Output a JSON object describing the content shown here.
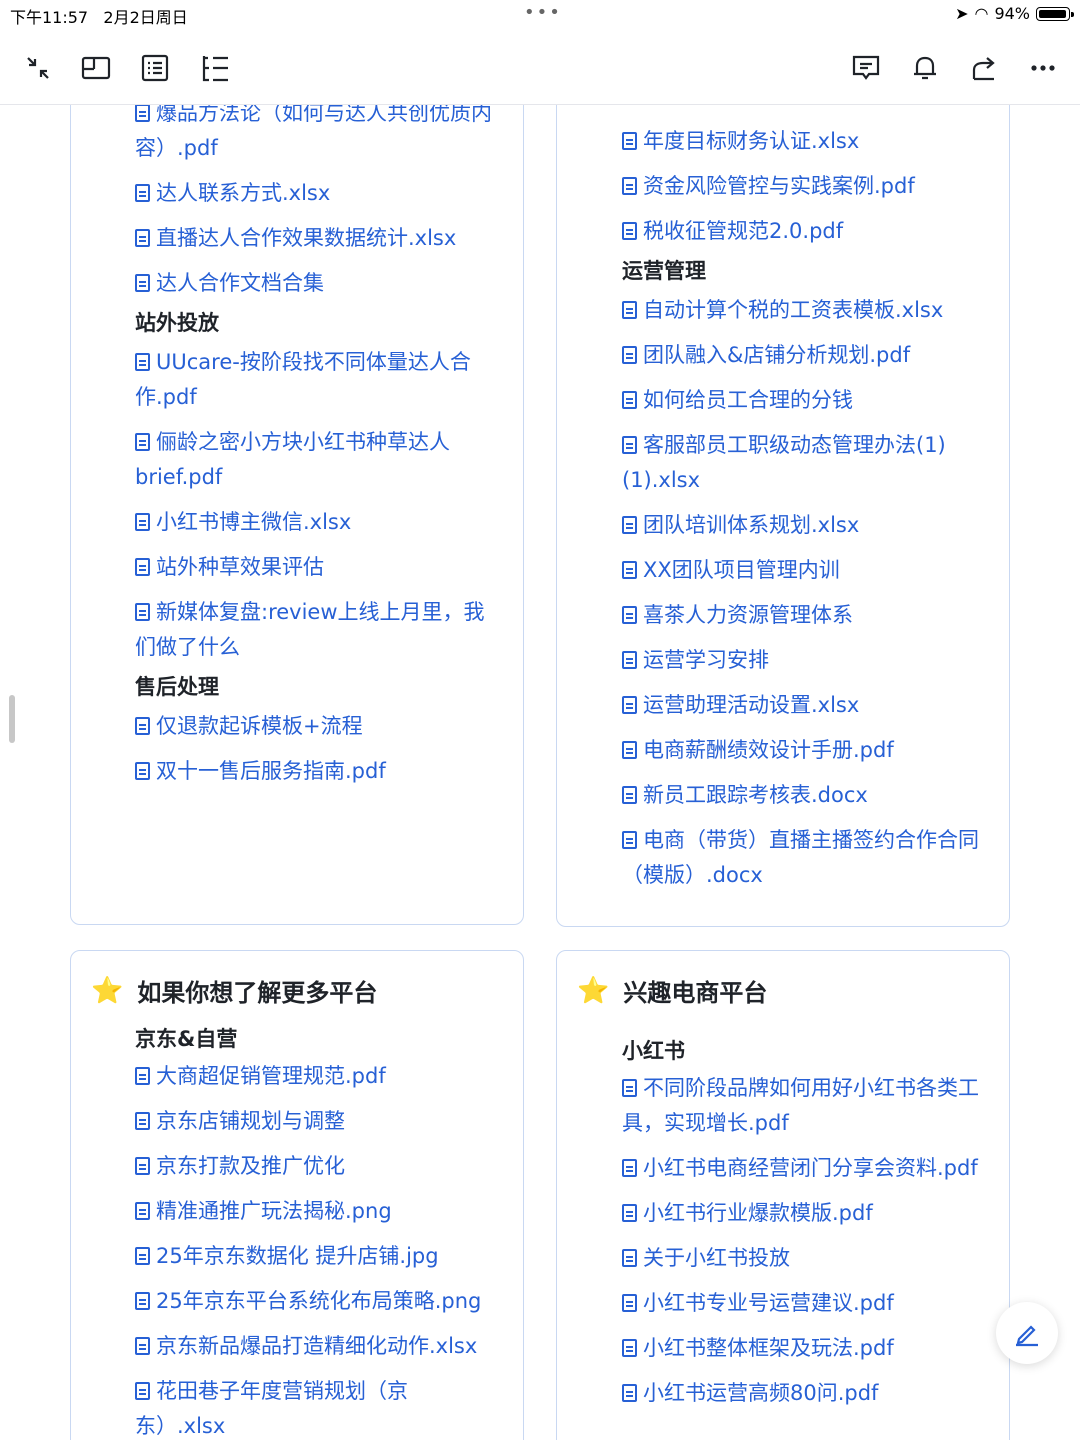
{
  "status": {
    "time": "下午11:57",
    "date": "2月2日周日",
    "battery": "94%"
  },
  "left_top": {
    "items_a": [
      "爆品方法论（如何与达人共创优质内容）.pdf",
      "达人联系方式.xlsx",
      "直播达人合作效果数据统计.xlsx",
      "达人合作文档合集"
    ],
    "heading1": "站外投放",
    "items_b": [
      "UUcare-按阶段找不同体量达人合作.pdf",
      "俪龄之密小方块小红书种草达人brief.pdf",
      "小红书博主微信.xlsx",
      "站外种草效果评估",
      "新媒体复盘:review上线上月里，我们做了什么"
    ],
    "heading2": "售后处理",
    "items_c": [
      "仅退款起诉模板+流程",
      "双十一售后服务指南.pdf"
    ]
  },
  "right_top": {
    "items_a": [
      "年度目标财务认证.xlsx",
      "资金风险管控与实践案例.pdf",
      "税收征管规范2.0.pdf"
    ],
    "heading1": "运营管理",
    "items_b": [
      "自动计算个税的工资表模板.xlsx",
      "团队融入&店铺分析规划.pdf",
      "如何给员工合理的分钱",
      "客服部员工职级动态管理办法(1)(1).xlsx",
      "团队培训体系规划.xlsx",
      "XX团队项目管理内训",
      "喜茶人力资源管理体系",
      "运营学习安排",
      "运营助理活动设置.xlsx",
      "电商薪酬绩效设计手册.pdf",
      "新员工跟踪考核表.docx",
      "电商（带货）直播主播签约合作合同（模版）.docx"
    ]
  },
  "left_bottom": {
    "title": "如果你想了解更多平台",
    "heading1": "京东&自营",
    "items": [
      "大商超促销管理规范.pdf",
      "京东店铺规划与调整",
      "京东打款及推广优化",
      "精准通推广玩法揭秘.png",
      "25年京东数据化 提升店铺.jpg",
      "25年京东平台系统化布局策略.png",
      "京东新品爆品打造精细化动作.xlsx",
      "花田巷子年度营销规划（京东）.xlsx"
    ]
  },
  "right_bottom": {
    "title": "兴趣电商平台",
    "heading1": "小红书",
    "items": [
      "不同阶段品牌如何用好小红书各类工具，实现增长.pdf",
      "小红书电商经营闭门分享会资料.pdf",
      "小红书行业爆款模版.pdf",
      "关于小红书投放",
      "小红书专业号运营建议.pdf",
      "小红书整体框架及玩法.pdf",
      "小红书运营高频80问.pdf"
    ]
  },
  "icons": {
    "toolbar_left": [
      "collapse-icon",
      "new-window-icon",
      "outline-icon",
      "tree-list-icon"
    ],
    "toolbar_right": [
      "comment-icon",
      "bell-icon",
      "share-icon",
      "more-icon"
    ]
  },
  "colors": {
    "link": "#2760d5",
    "card_border": "#c9d8f2",
    "star": "#f5b301"
  }
}
